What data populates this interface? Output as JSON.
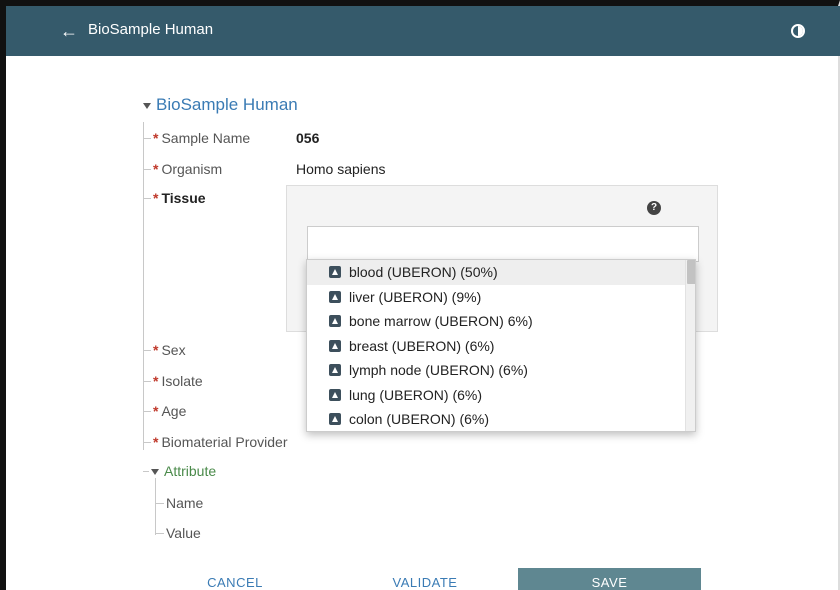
{
  "header": {
    "title": "BioSample Human"
  },
  "section": {
    "title": "BioSample Human"
  },
  "fields": {
    "sample_name": {
      "label": "Sample Name",
      "value": "056"
    },
    "organism": {
      "label": "Organism",
      "value": "Homo sapiens"
    },
    "tissue": {
      "label": "Tissue",
      "help": "?"
    },
    "sex": {
      "label": "Sex"
    },
    "isolate": {
      "label": "Isolate"
    },
    "age": {
      "label": "Age"
    },
    "biomaterial_provider": {
      "label": "Biomaterial Provider"
    },
    "required_marker": "*"
  },
  "suggestions": [
    {
      "label": "blood (UBERON)  (50%)"
    },
    {
      "label": "liver (UBERON) (9%)"
    },
    {
      "label": "bone marrow (UBERON) 6%)"
    },
    {
      "label": "breast (UBERON) (6%)"
    },
    {
      "label": "lymph node (UBERON) (6%)"
    },
    {
      "label": "lung (UBERON) (6%)"
    },
    {
      "label": "colon (UBERON) (6%)"
    }
  ],
  "attribute": {
    "label": "Attribute",
    "name_label": "Name",
    "value_label": "Value"
  },
  "actions": {
    "cancel": "CANCEL",
    "validate": "VALIDATE",
    "save": "SAVE"
  },
  "colors": {
    "topbar": "#355a6b",
    "accent": "#3a7bb4",
    "required": "#c0392b",
    "save_button": "#5f8791"
  },
  "icons": {
    "back": "arrow-left-icon",
    "contrast": "contrast-icon",
    "help": "question-circle-icon",
    "ontology": "ontology-icon"
  }
}
